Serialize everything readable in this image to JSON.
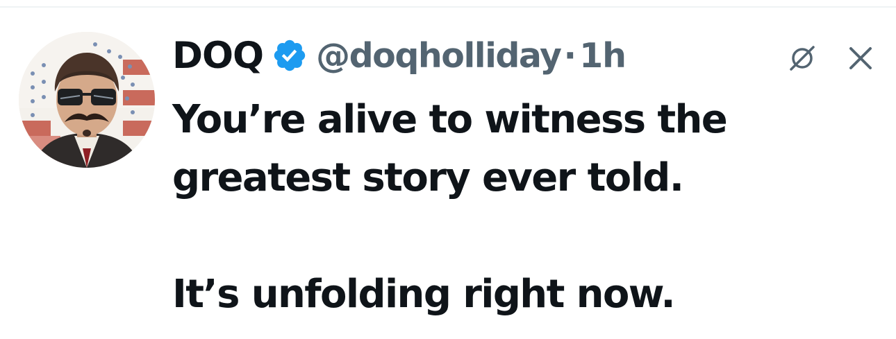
{
  "tweet": {
    "author": {
      "display_name": "DOQ",
      "handle": "@doqholliday",
      "verified": true,
      "verified_color": "#1d9bf0"
    },
    "separator": "·",
    "timestamp": "1h",
    "body": {
      "line1": "You’re alive to witness the",
      "line2": "greatest story ever told.",
      "line3": "It’s unfolding right now."
    },
    "actions": {
      "left_icon": "grok-icon",
      "right_icon": "close-icon"
    }
  },
  "colors": {
    "text_primary": "#0f1419",
    "text_secondary": "#536471",
    "accent": "#1d9bf0",
    "divider": "#eff3f4"
  }
}
